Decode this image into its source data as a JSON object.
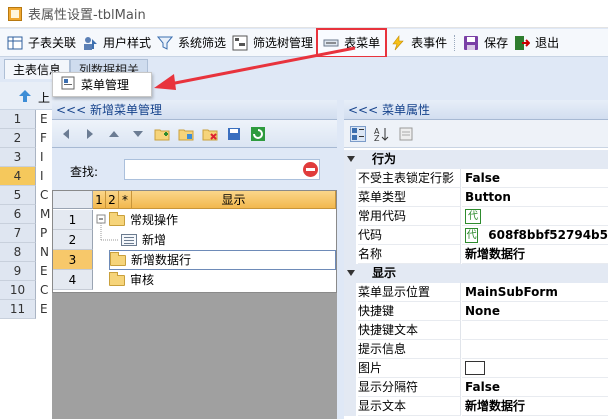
{
  "window": {
    "title": "表属性设置-tblMain"
  },
  "toolbar": {
    "items": [
      {
        "label": "子表关联",
        "icon": "table-link-icon"
      },
      {
        "label": "用户样式",
        "icon": "user-style-icon"
      },
      {
        "label": "系统筛选",
        "icon": "filter-icon"
      },
      {
        "label": "筛选树管理",
        "icon": "tree-filter-icon"
      },
      {
        "label": "表菜单",
        "icon": "menu-icon"
      },
      {
        "label": "表事件",
        "icon": "lightning-icon"
      },
      {
        "label": "保存",
        "icon": "save-icon"
      },
      {
        "label": "退出",
        "icon": "exit-icon"
      }
    ]
  },
  "tabs": [
    {
      "label": "主表信息"
    },
    {
      "label": "列数据相关"
    }
  ],
  "background_grid": {
    "rows": [
      {
        "num": "1",
        "char": "E"
      },
      {
        "num": "2",
        "char": "F"
      },
      {
        "num": "3",
        "char": "I"
      },
      {
        "num": "4",
        "char": "I"
      },
      {
        "num": "5",
        "char": "C"
      },
      {
        "num": "6",
        "char": "M"
      },
      {
        "num": "7",
        "char": "P"
      },
      {
        "num": "8",
        "char": "N"
      },
      {
        "num": "9",
        "char": "E"
      },
      {
        "num": "10",
        "char": "C"
      },
      {
        "num": "11",
        "char": "E"
      }
    ],
    "selected": "4"
  },
  "popup": {
    "label": "菜单管理"
  },
  "left_panel": {
    "header": "<<< 新增菜单管理",
    "search_label": "查找:",
    "search_value": "",
    "columns": [
      "1",
      "2",
      "*",
      "显示"
    ],
    "rows": [
      {
        "num": "1",
        "text": "常规操作",
        "type": "folder-open"
      },
      {
        "num": "2",
        "text": "新增",
        "type": "form"
      },
      {
        "num": "3",
        "text": "新增数据行",
        "type": "folder"
      },
      {
        "num": "4",
        "text": "审核",
        "type": "folder"
      }
    ],
    "selected_row": "3"
  },
  "right_panel": {
    "header": "<<< 菜单属性",
    "categories": [
      {
        "name": "行为",
        "props": [
          {
            "name": "不受主表锁定行影",
            "value": "False"
          },
          {
            "name": "菜单类型",
            "value": "Button"
          },
          {
            "name": "常用代码",
            "value": "",
            "badge": "代"
          },
          {
            "name": "代码",
            "value": "608f8bbf52794b5",
            "badge": "代"
          },
          {
            "name": "名称",
            "value": "新增数据行"
          }
        ]
      },
      {
        "name": "显示",
        "props": [
          {
            "name": "菜单显示位置",
            "value": "MainSubForm"
          },
          {
            "name": "快捷键",
            "value": "None"
          },
          {
            "name": "快捷键文本",
            "value": ""
          },
          {
            "name": "提示信息",
            "value": ""
          },
          {
            "name": "图片",
            "value": "",
            "image": true
          },
          {
            "name": "显示分隔符",
            "value": "False"
          },
          {
            "name": "显示文本",
            "value": "新增数据行"
          }
        ]
      }
    ]
  },
  "colors": {
    "highlight_border": "#e8333d",
    "selected_row": "#f7c86a",
    "panel_header_text": "#15428b"
  }
}
